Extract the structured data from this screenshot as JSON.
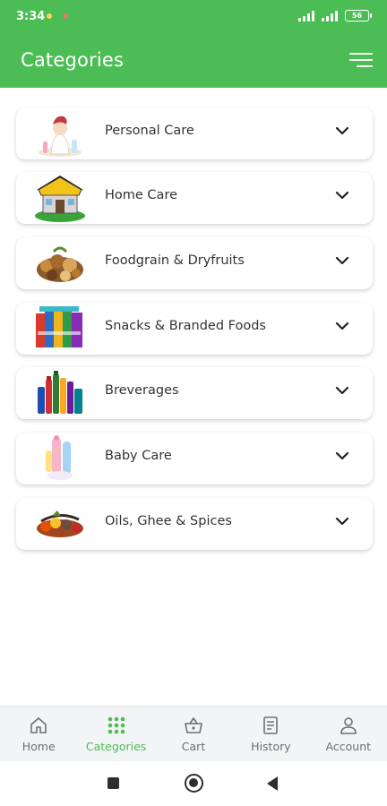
{
  "status_bar": {
    "time": "3:34",
    "battery": "56"
  },
  "app_bar": {
    "title": "Categories"
  },
  "categories": [
    {
      "label": "Personal Care",
      "icon": "personal-care-image"
    },
    {
      "label": "Home Care",
      "icon": "home-care-image"
    },
    {
      "label": "Foodgrain & Dryfruits",
      "icon": "foodgrain-image"
    },
    {
      "label": "Snacks & Branded Foods",
      "icon": "snacks-image"
    },
    {
      "label": "Breverages",
      "icon": "beverages-image"
    },
    {
      "label": "Baby Care",
      "icon": "baby-care-image"
    },
    {
      "label": "Oils, Ghee & Spices",
      "icon": "oils-spices-image"
    }
  ],
  "bottom_nav": {
    "home": "Home",
    "categories": "Categories",
    "cart": "Cart",
    "history": "History",
    "account": "Account"
  },
  "colors": {
    "brand_green": "#4cbd54",
    "nav_inactive": "#6e6e6e"
  }
}
